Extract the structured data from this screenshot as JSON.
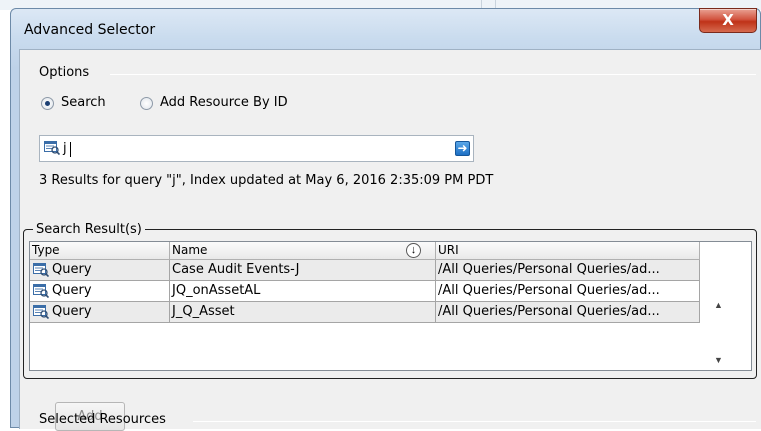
{
  "window": {
    "title": "Advanced Selector",
    "close_label": "X"
  },
  "options": {
    "title": "Options",
    "radio_search": "Search",
    "radio_add_by_id": "Add Resource By ID"
  },
  "search": {
    "value": "j",
    "go_icon": "arrow-right-icon"
  },
  "status": {
    "text": "3 Results for query \"j\", Index updated at May 6, 2016 2:35:09 PM PDT"
  },
  "results": {
    "title": "Search Result(s)",
    "columns": [
      "Type",
      "Name",
      "URI"
    ],
    "rows": [
      {
        "type": "Query",
        "name": "Case Audit Events-J",
        "uri": "/All Queries/Personal Queries/ad..."
      },
      {
        "type": "Query",
        "name": "JQ_onAssetAL",
        "uri": "/All Queries/Personal Queries/ad..."
      },
      {
        "type": "Query",
        "name": "J_Q_Asset",
        "uri": "/All Queries/Personal Queries/ad..."
      }
    ]
  },
  "buttons": {
    "add": "Add"
  },
  "selected": {
    "title": "Selected Resources"
  },
  "colors": {
    "title_bar": "#c9dbee",
    "close_button": "#c7432a",
    "accent": "#1d6fc4"
  }
}
